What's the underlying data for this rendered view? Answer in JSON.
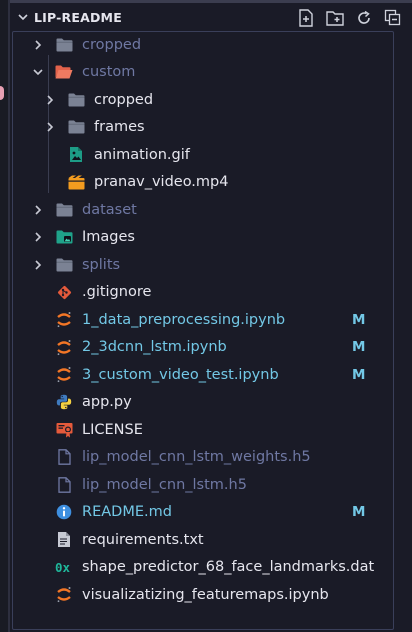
{
  "explorer": {
    "title": "LIP-README",
    "actions": [
      {
        "name": "new-file-icon"
      },
      {
        "name": "new-folder-icon"
      },
      {
        "name": "refresh-icon"
      },
      {
        "name": "collapse-all-icon"
      }
    ]
  },
  "tree": [
    {
      "label": "cropped",
      "type": "folder",
      "depth": 0,
      "expanded": false,
      "dim": true,
      "icon": "folder-icon",
      "color": "#6f78a3"
    },
    {
      "label": "custom",
      "type": "folder",
      "depth": 0,
      "expanded": true,
      "dim": true,
      "icon": "folder-open-icon",
      "color": "#6f78a3"
    },
    {
      "label": "cropped",
      "type": "folder",
      "depth": 1,
      "expanded": false,
      "icon": "folder-icon",
      "color": "#e6e6ee"
    },
    {
      "label": "frames",
      "type": "folder",
      "depth": 1,
      "expanded": false,
      "icon": "folder-icon",
      "color": "#e6e6ee"
    },
    {
      "label": "animation.gif",
      "type": "file",
      "depth": 1,
      "icon": "image-file-icon",
      "color": "#e6e6ee"
    },
    {
      "label": "pranav_video.mp4",
      "type": "file",
      "depth": 1,
      "icon": "video-file-icon",
      "color": "#e6e6ee"
    },
    {
      "label": "dataset",
      "type": "folder",
      "depth": 0,
      "expanded": false,
      "dim": true,
      "icon": "folder-icon",
      "color": "#6f78a3"
    },
    {
      "label": "Images",
      "type": "folder",
      "depth": 0,
      "expanded": false,
      "icon": "images-folder-icon",
      "color": "#e6e6ee"
    },
    {
      "label": "splits",
      "type": "folder",
      "depth": 0,
      "expanded": false,
      "dim": true,
      "icon": "folder-icon",
      "color": "#6f78a3"
    },
    {
      "label": ".gitignore",
      "type": "file",
      "depth": 0,
      "icon": "git-icon",
      "color": "#e6e6ee"
    },
    {
      "label": "1_data_preprocessing.ipynb",
      "type": "file",
      "depth": 0,
      "icon": "jupyter-icon",
      "color": "#73c8e6",
      "badge": "M"
    },
    {
      "label": "2_3dcnn_lstm.ipynb",
      "type": "file",
      "depth": 0,
      "icon": "jupyter-icon",
      "color": "#73c8e6",
      "badge": "M"
    },
    {
      "label": "3_custom_video_test.ipynb",
      "type": "file",
      "depth": 0,
      "icon": "jupyter-icon",
      "color": "#73c8e6",
      "badge": "M"
    },
    {
      "label": "app.py",
      "type": "file",
      "depth": 0,
      "icon": "python-icon",
      "color": "#e6e6ee"
    },
    {
      "label": "LICENSE",
      "type": "file",
      "depth": 0,
      "icon": "license-icon",
      "color": "#e6e6ee"
    },
    {
      "label": "lip_model_cnn_lstm_weights.h5",
      "type": "file",
      "depth": 0,
      "icon": "file-icon",
      "color": "#6f78a3"
    },
    {
      "label": "lip_model_cnn_lstm.h5",
      "type": "file",
      "depth": 0,
      "icon": "file-icon",
      "color": "#6f78a3"
    },
    {
      "label": "README.md",
      "type": "file",
      "depth": 0,
      "icon": "info-icon",
      "color": "#73c8e6",
      "badge": "M"
    },
    {
      "label": "requirements.txt",
      "type": "file",
      "depth": 0,
      "icon": "text-file-icon",
      "color": "#e6e6ee"
    },
    {
      "label": "shape_predictor_68_face_landmarks.dat",
      "type": "file",
      "depth": 0,
      "icon": "hex-file-icon",
      "color": "#e6e6ee"
    },
    {
      "label": "visualizatizing_featuremaps.ipynb",
      "type": "file",
      "depth": 0,
      "icon": "jupyter-icon",
      "color": "#e6e6ee"
    }
  ]
}
